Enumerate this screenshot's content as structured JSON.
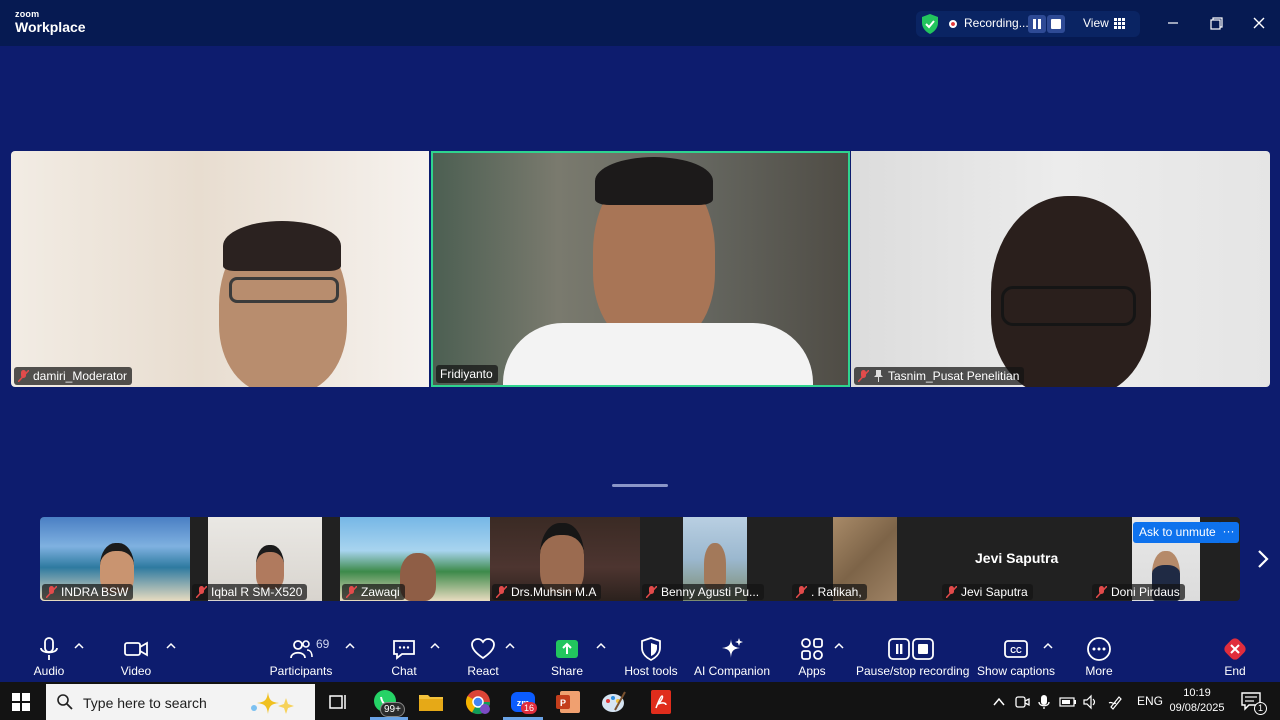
{
  "app": {
    "logo_small": "zoom",
    "logo_big": "Workplace"
  },
  "recording": {
    "status": "Recording...",
    "view_label": "View"
  },
  "main_tiles": [
    {
      "name": "damiri_Moderator"
    },
    {
      "name": "Fridiyanto"
    },
    {
      "name": "Tasnim_Pusat Penelitian"
    }
  ],
  "gallery": [
    {
      "name": "INDRA BSW"
    },
    {
      "name": "Iqbal R SM-X520"
    },
    {
      "name": "Zawaqi"
    },
    {
      "name": "Drs.Muhsin M.A"
    },
    {
      "name": "Benny Agusti Pu..."
    },
    {
      "name": ". Rafikah,"
    },
    {
      "name": "Jevi Saputra",
      "big_name": "Jevi Saputra"
    },
    {
      "name": "Doni Pirdaus"
    }
  ],
  "overlay": {
    "ask_unmute": "Ask to unmute",
    "more": "···"
  },
  "toolbar": {
    "audio": "Audio",
    "video": "Video",
    "participants": "Participants",
    "participants_count": "69",
    "chat": "Chat",
    "react": "React",
    "share": "Share",
    "host_tools": "Host tools",
    "ai_companion": "AI Companion",
    "apps": "Apps",
    "pause_stop": "Pause/stop recording",
    "captions": "Show captions",
    "more": "More",
    "end": "End"
  },
  "taskbar": {
    "search_placeholder": "Type here to search",
    "whatsapp_badge": "99+",
    "zoom_badge": "16",
    "language": "ENG",
    "time": "10:19",
    "date": "09/08/2025",
    "notification_count": "1"
  },
  "colors": {
    "meeting_bg": "#0d1c6e",
    "active_speaker_border": "#2fd38f",
    "share_green": "#22c55e",
    "end_red": "#e02d3c",
    "accent_blue": "#0e72ed"
  }
}
